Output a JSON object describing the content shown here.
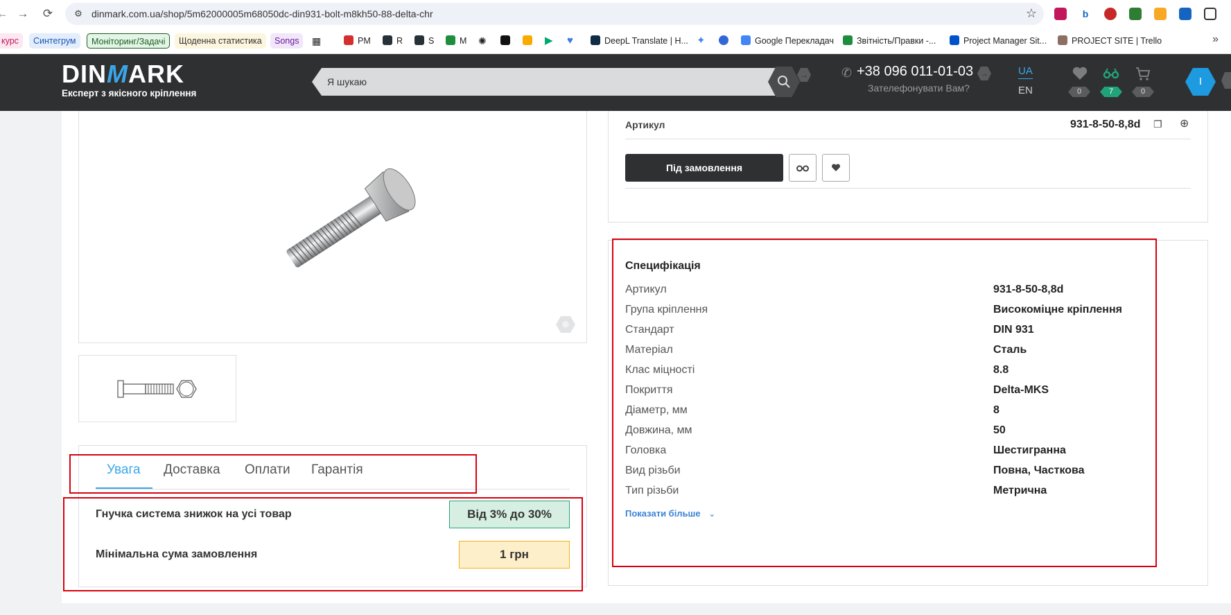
{
  "browser": {
    "url": "dinmark.com.ua/shop/5m62000005m68050dc-din931-bolt-m8kh50-88-delta-chr",
    "bookmarks": [
      {
        "label": "курс",
        "style": "chip-pink"
      },
      {
        "label": "Синтегрум",
        "style": "chip-blue"
      },
      {
        "label": "Моніторинг/Задачі",
        "style": "chip-green"
      },
      {
        "label": "Щоденна статистика",
        "style": "chip-yellow"
      },
      {
        "label": "Songs",
        "style": "chip-purple"
      },
      {
        "label": "PM",
        "style": "fav"
      },
      {
        "label": "R",
        "style": "fav"
      },
      {
        "label": "S",
        "style": "fav"
      },
      {
        "label": "M",
        "style": "fav"
      },
      {
        "label": "DeepL Translate | H...",
        "style": "fav"
      },
      {
        "label": "Google Перекладач",
        "style": "fav"
      },
      {
        "label": "Звітність/Правки -...",
        "style": "fav"
      },
      {
        "label": "Project Manager Sit...",
        "style": "fav"
      },
      {
        "label": "PROJECT SITE | Trello",
        "style": "fav"
      }
    ]
  },
  "header": {
    "logo_text": "DINMARK",
    "tagline": "Експерт з якісного кріплення",
    "search_placeholder": "Я шукаю",
    "phone": "+38 096 011-01-03",
    "callback": "Зателефонувати Вам?",
    "lang_active": "UA",
    "lang_other": "EN",
    "favorites_count": "0",
    "compare_count": "7",
    "cart_count": "0",
    "user_initial": "I"
  },
  "product": {
    "sku_label": "Артикул",
    "sku_value": "931-8-50-8,8d",
    "order_button": "Під замовлення"
  },
  "info_tabs": {
    "tabs": [
      "Увага",
      "Доставка",
      "Оплати",
      "Гарантія"
    ],
    "active_index": 0,
    "rows": [
      {
        "label": "Гнучка система знижок на усі товар",
        "value": "Від 3% до 30%"
      },
      {
        "label": "Мінімальна сума замовлення",
        "value": "1 грн"
      }
    ]
  },
  "specification": {
    "title": "Специфікація",
    "rows": [
      {
        "key": "Артикул",
        "value": "931-8-50-8,8d"
      },
      {
        "key": "Група кріплення",
        "value": "Високоміцне кріплення"
      },
      {
        "key": "Стандарт",
        "value": "DIN 931"
      },
      {
        "key": "Матеріал",
        "value": "Сталь"
      },
      {
        "key": "Клас міцності",
        "value": "8.8"
      },
      {
        "key": "Покриття",
        "value": "Delta-MKS"
      },
      {
        "key": "Діаметр, мм",
        "value": "8"
      },
      {
        "key": "Довжина, мм",
        "value": "50"
      },
      {
        "key": "Головка",
        "value": "Шестигранна"
      },
      {
        "key": "Вид різьби",
        "value": "Повна, Часткова"
      },
      {
        "key": "Тип різьби",
        "value": "Метрична"
      }
    ],
    "show_more": "Показати більше"
  },
  "colors": {
    "header_bg": "#2f3032",
    "accent_blue": "#3aa6e8",
    "annotation_red": "#d8000f",
    "discount_green": "#22a57a",
    "min_order_yellow": "#f3b421"
  }
}
